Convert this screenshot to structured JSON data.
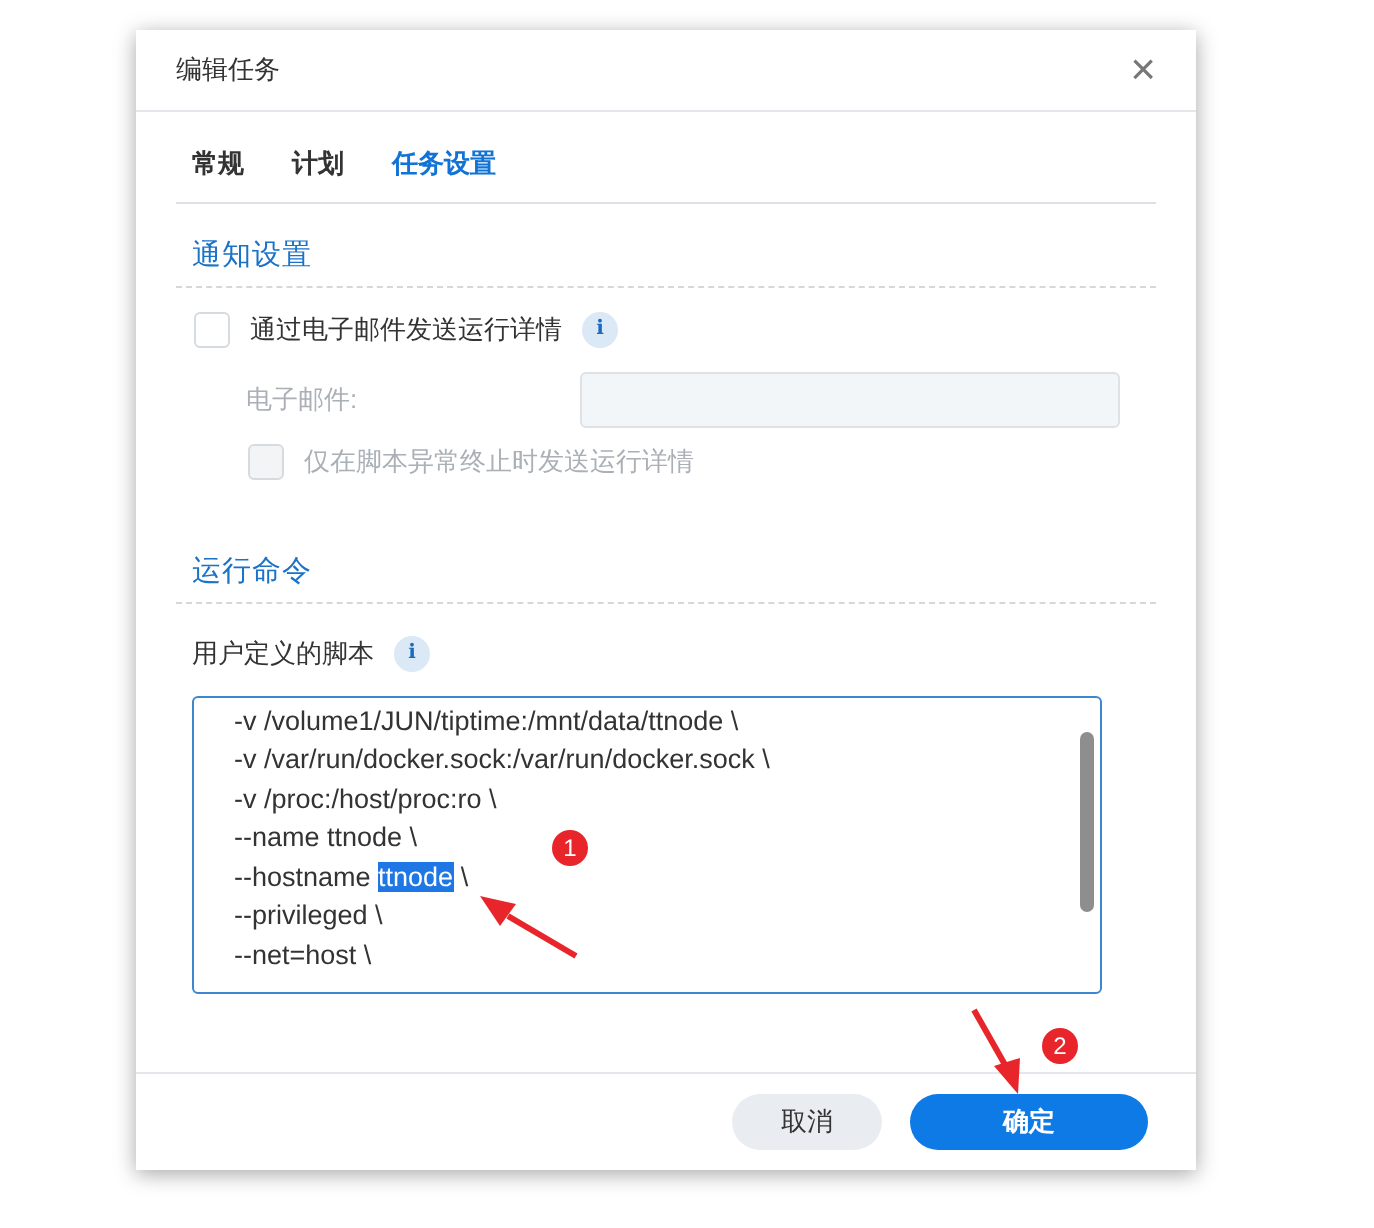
{
  "window": {
    "title": "编辑任务",
    "close": "×"
  },
  "tabs": [
    {
      "label": "常规",
      "selected": false
    },
    {
      "label": "计划",
      "selected": false
    },
    {
      "label": "任务设置",
      "selected": true
    }
  ],
  "notification": {
    "title": "通知设置",
    "email_option": {
      "label": "通过电子邮件发送运行详情",
      "checked": false,
      "info": "i"
    },
    "email_field": {
      "label": "电子邮件:",
      "disabled": true
    },
    "abnormal_option": {
      "label": "仅在脚本异常终止时发送运行详情",
      "checked": false,
      "disabled": true
    }
  },
  "command": {
    "title": "运行命令",
    "script_label": "用户定义的脚本",
    "info": "i",
    "script_lines": [
      {
        "before": "-v /volume1/JUN/tiptime:/mnt/data/ttnode \\"
      },
      {
        "before": "-v /var/run/docker.sock:/var/run/docker.sock \\"
      },
      {
        "before": "-v /proc:/host/proc:ro \\"
      },
      {
        "before": "--name ttnode \\"
      },
      {
        "before": "--hostname ",
        "selected": "ttnode",
        "after": " \\"
      },
      {
        "before": "--privileged \\"
      },
      {
        "before": "--net=host \\"
      }
    ]
  },
  "buttons": [
    {
      "label": "取消",
      "kind": "secondary"
    },
    {
      "label": "确定",
      "kind": "primary"
    }
  ],
  "annotations": [
    {
      "label": "1",
      "kind": "selection"
    },
    {
      "label": "2",
      "kind": "confirm"
    }
  ]
}
